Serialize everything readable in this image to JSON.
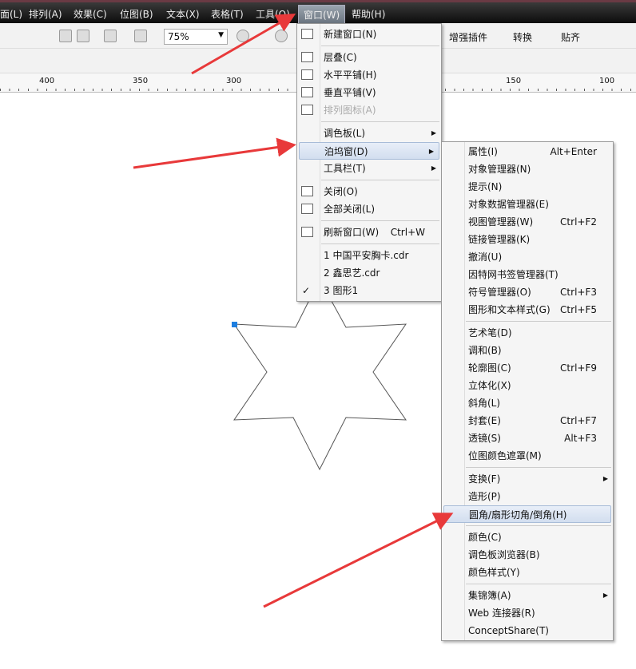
{
  "menubar": {
    "items": [
      "面(L)",
      "排列(A)",
      "效果(C)",
      "位图(B)",
      "文本(X)",
      "表格(T)",
      "工具(O)",
      "窗口(W)",
      "帮助(H)"
    ],
    "active": "窗口(W)"
  },
  "toolbar": {
    "zoom": "75%",
    "plugins": "增强插件",
    "convert": "转换",
    "snap": "贴齐"
  },
  "ruler": {
    "labels": [
      "400",
      "350",
      "300",
      "150",
      "100"
    ]
  },
  "window_menu": [
    {
      "label": "新建窗口(N)",
      "icon": "new-window-icon"
    },
    {
      "sep": true
    },
    {
      "label": "层叠(C)",
      "icon": "cascade-icon"
    },
    {
      "label": "水平平铺(H)",
      "icon": "tile-horizontal-icon"
    },
    {
      "label": "垂直平铺(V)",
      "icon": "tile-vertical-icon"
    },
    {
      "label": "排列图标(A)",
      "icon": "arrange-icons-icon",
      "disabled": true
    },
    {
      "sep": true
    },
    {
      "label": "调色板(L)",
      "submenu": true
    },
    {
      "label": "泊坞窗(D)",
      "submenu": true,
      "highlighted": true
    },
    {
      "label": "工具栏(T)",
      "submenu": true
    },
    {
      "sep": true
    },
    {
      "label": "关闭(O)",
      "icon": "close-window-icon"
    },
    {
      "label": "全部关闭(L)",
      "icon": "close-all-icon"
    },
    {
      "sep": true
    },
    {
      "label": "刷新窗口(W)",
      "icon": "refresh-icon",
      "shortcut": "Ctrl+W"
    },
    {
      "sep": true
    },
    {
      "label": "1 中国平安胸卡.cdr"
    },
    {
      "label": "2 鑫思艺.cdr"
    },
    {
      "label": "3 图形1",
      "checked": true
    }
  ],
  "docker_menu": [
    {
      "label": "属性(I)",
      "shortcut": "Alt+Enter"
    },
    {
      "label": "对象管理器(N)"
    },
    {
      "label": "提示(N)"
    },
    {
      "label": "对象数据管理器(E)"
    },
    {
      "label": "视图管理器(W)",
      "shortcut": "Ctrl+F2"
    },
    {
      "label": "链接管理器(K)"
    },
    {
      "label": "撤消(U)"
    },
    {
      "label": "因特网书签管理器(T)"
    },
    {
      "label": "符号管理器(O)",
      "shortcut": "Ctrl+F3"
    },
    {
      "label": "图形和文本样式(G)",
      "shortcut": "Ctrl+F5"
    },
    {
      "sep": true
    },
    {
      "label": "艺术笔(D)"
    },
    {
      "label": "调和(B)"
    },
    {
      "label": "轮廓图(C)",
      "shortcut": "Ctrl+F9"
    },
    {
      "label": "立体化(X)"
    },
    {
      "label": "斜角(L)"
    },
    {
      "label": "封套(E)",
      "shortcut": "Ctrl+F7"
    },
    {
      "label": "透镜(S)",
      "shortcut": "Alt+F3"
    },
    {
      "label": "位图颜色遮罩(M)"
    },
    {
      "sep": true
    },
    {
      "label": "变换(F)",
      "submenu": true
    },
    {
      "label": "造形(P)"
    },
    {
      "label": "圆角/扇形切角/倒角(H)",
      "highlighted": true
    },
    {
      "sep": true
    },
    {
      "label": "颜色(C)"
    },
    {
      "label": "调色板浏览器(B)"
    },
    {
      "label": "颜色样式(Y)"
    },
    {
      "sep": true
    },
    {
      "label": "集锦簿(A)",
      "submenu": true
    },
    {
      "label": "Web 连接器(R)"
    },
    {
      "label": "ConceptShare(T)"
    }
  ],
  "colors": {
    "arrow": "#e8393a",
    "selection": "#1e7fe0"
  }
}
